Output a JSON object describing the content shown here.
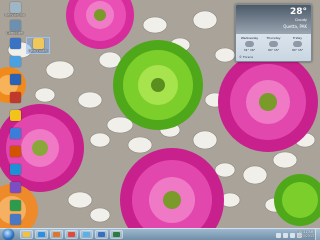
{
  "desktop": {
    "icons": [
      {
        "label": "Recycle Bin",
        "color": "#9fb6c7"
      },
      {
        "label": "Computer",
        "color": "#6d8fb0"
      },
      {
        "label": "",
        "color": "#3a73c4"
      },
      {
        "label": "",
        "color": "#4aa0e0"
      },
      {
        "label": "",
        "color": "#2a63b5"
      },
      {
        "label": "",
        "color": "#c0392b"
      },
      {
        "label": "",
        "color": "#f0c419"
      },
      {
        "label": "",
        "color": "#3b7dd8"
      },
      {
        "label": "",
        "color": "#d35400"
      },
      {
        "label": "",
        "color": "#1f8fd6"
      },
      {
        "label": "",
        "color": "#7c4ec4"
      },
      {
        "label": "",
        "color": "#2c9b4b"
      },
      {
        "label": "",
        "color": "#4a78c2"
      }
    ],
    "selected_icon": "New Folder"
  },
  "weather": {
    "temperature": "28°",
    "condition": "Cloudy",
    "city": "Quetta, PAK",
    "days": [
      {
        "name": "Wednesday",
        "temp": "31° 16°"
      },
      {
        "name": "Thursday",
        "temp": "30° 15°"
      },
      {
        "name": "Friday",
        "temp": "30° 15°"
      }
    ],
    "source": "© Foreca"
  },
  "taskbar": {
    "pinned": [
      {
        "name": "explorer",
        "color": "#f3c13a"
      },
      {
        "name": "ie",
        "color": "#2b8ee0"
      },
      {
        "name": "media",
        "color": "#e0762b"
      },
      {
        "name": "chrome",
        "color": "#e04a3b"
      },
      {
        "name": "app5",
        "color": "#5bb0e8"
      },
      {
        "name": "app6",
        "color": "#3a6fbf"
      },
      {
        "name": "app7",
        "color": "#2f7b3f"
      }
    ],
    "time": "10:41 AM",
    "date": "9/24/2013"
  }
}
